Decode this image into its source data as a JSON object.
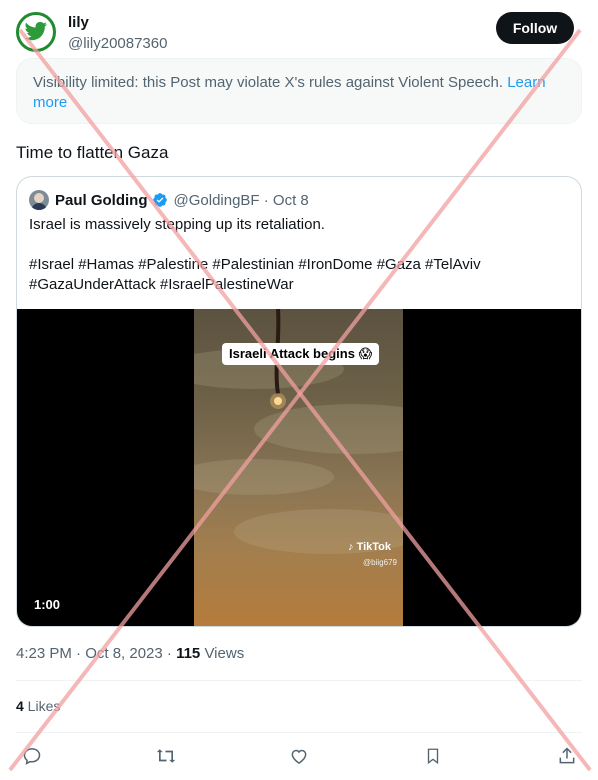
{
  "author": {
    "name": "lily",
    "handle": "@lily20087360",
    "avatar_icon": "twitter-bird-icon",
    "follow_label": "Follow"
  },
  "notice": {
    "text": "Visibility limited: this Post may violate X's rules against Violent Speech. ",
    "link": "Learn more"
  },
  "post": {
    "text": "Time to flatten Gaza"
  },
  "quote": {
    "name": "Paul Golding",
    "handle_date": "@GoldingBF · Oct 8",
    "text": "Israel is massively stepping up its retaliation.",
    "hashtags_line1": "#Israel #Hamas #Palestine #Palestinian #IronDome #Gaza #TelAviv",
    "hashtags_line2": "#GazaUnderAttack #IsraelPalestineWar",
    "video": {
      "caption": "Israeli Attack begins 😱",
      "watermark": "TikTok",
      "watermark_handle": "@biig679",
      "duration": "1:00"
    }
  },
  "meta": {
    "time_date": "4:23 PM · Oct 8, 2023 · ",
    "views_count": "115",
    "views_label": " Views",
    "likes_count": "4",
    "likes_label": " Likes"
  },
  "colors": {
    "accent": "#1d9bf0",
    "overlay_cross": "#f2a0a0"
  }
}
